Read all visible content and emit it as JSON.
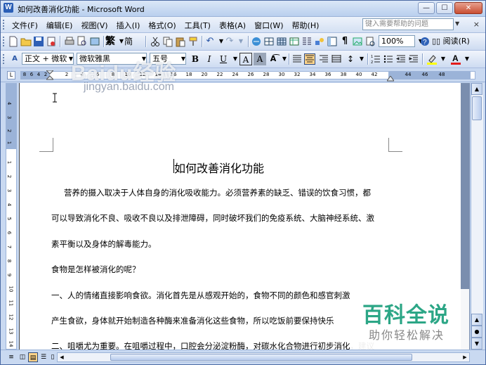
{
  "window": {
    "title": "如何改善消化功能 - Microsoft Word",
    "app_icon": "W",
    "controls": [
      "—",
      "☐",
      "✕"
    ]
  },
  "menu": {
    "items": [
      "文件(F)",
      "编辑(E)",
      "视图(V)",
      "插入(I)",
      "格式(O)",
      "工具(T)",
      "表格(A)",
      "窗口(W)",
      "帮助(H)"
    ],
    "help_placeholder": "键入需要帮助的问题",
    "close": "×"
  },
  "standard_toolbar": {
    "zoom": "100%",
    "read_label": "阅读(R)",
    "trad_char": "繁",
    "simp_char": "简"
  },
  "formatting_toolbar": {
    "style": "正文 + 微软",
    "font": "微软雅黑",
    "size": "五号",
    "bold": "B",
    "italic": "I",
    "underline": "U",
    "char_border": "A",
    "char_shade": "A"
  },
  "ruler": {
    "labels": [
      "8",
      "6",
      "4",
      "2",
      "2",
      "4",
      "6",
      "8",
      "10",
      "12",
      "14",
      "16",
      "18",
      "20",
      "22",
      "24",
      "26",
      "28",
      "30",
      "32",
      "34",
      "36",
      "38",
      "40",
      "42",
      "44",
      "46",
      "48"
    ],
    "vertical_labels": [
      "4",
      "3",
      "2",
      "1",
      "1",
      "2",
      "3",
      "4",
      "5",
      "6",
      "7",
      "8",
      "9",
      "10",
      "11",
      "12",
      "13",
      "14"
    ]
  },
  "document": {
    "title": "如何改善消化功能",
    "paragraphs": [
      "营养的摄入取决于人体自身的消化吸收能力。必须营养素的缺乏、错误的饮食习惯，都",
      "可以导致消化不良、吸收不良以及排泄障碍，同时破坏我们的免疫系统、大脑神经系统、激",
      "素平衡以及身体的解毒能力。",
      "食物是怎样被消化的呢？",
      "一、人的情绪直接影响食欲。消化首先是从感观开始的，食物不同的颜色和感官刺激",
      "产生食欲，身体就开始制造各种酶来准备消化这些食物，所以吃饭前要保持快乐",
      "二、咀嚼尤为重要。在咀嚼过程中，口腔会分泌淀粉酶，对碳水化合物进行初步消化，建议"
    ]
  },
  "watermark": {
    "brand": "Baidu经验",
    "url": "jingyan.baidu.com"
  },
  "badge": {
    "title": "百科全说",
    "subtitle": "助你轻松解决"
  }
}
